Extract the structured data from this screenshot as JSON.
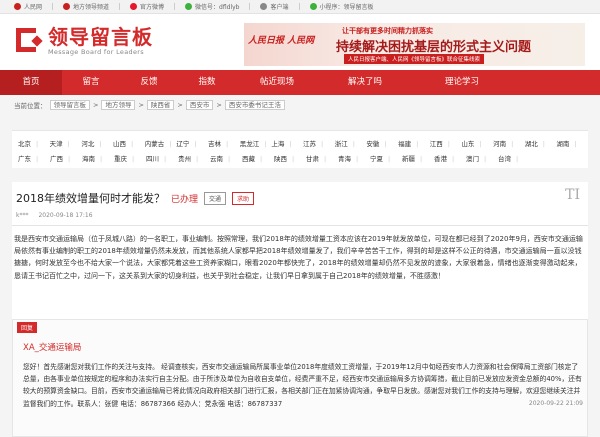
{
  "topbar": {
    "items": [
      {
        "label": "人民网",
        "icon": "people-daily-icon",
        "color": "#c9201f"
      },
      {
        "label": "地方领导频道",
        "icon": "channel-icon",
        "color": "#c9201f"
      },
      {
        "label": "官方微博",
        "icon": "weibo-icon",
        "color": "#e6162d"
      },
      {
        "label": "微信号：dfldlyb",
        "icon": "wechat-icon",
        "color": "#3db13d"
      },
      {
        "label": "客户端",
        "icon": "phone-icon",
        "color": "#888888"
      },
      {
        "label": "小程序：领导留言板",
        "icon": "miniprogram-icon",
        "color": "#3db13d"
      }
    ]
  },
  "header": {
    "logo_cn": "领导留言板",
    "logo_en": "Message Board for Leaders",
    "banner": {
      "logo": "人民日报 人民网",
      "line1": "让干部有更多时间精力抓落实",
      "line2": "持续解决困扰基层的形式主义问题",
      "line3": "人民日报客户端、人民网《领导留言板》联合征集线索"
    }
  },
  "nav": {
    "items": [
      "首页",
      "留言",
      "反馈",
      "指数",
      "帖近现场",
      "解决了吗",
      "理论学习"
    ],
    "active_index": 0
  },
  "breadcrumb": {
    "label": "当前位置：",
    "parts": [
      "领导留言板",
      "地方领导",
      "陕西省",
      "西安市",
      "西安市委书记王浩"
    ]
  },
  "regions": {
    "row1": [
      "北京",
      "天津",
      "河北",
      "山西",
      "内蒙古",
      "辽宁",
      "吉林",
      "黑龙江",
      "上海",
      "江苏",
      "浙江",
      "安徽",
      "福建",
      "江西",
      "山东",
      "河南",
      "湖北",
      "湖南"
    ],
    "row2": [
      "广东",
      "广西",
      "海南",
      "重庆",
      "四川",
      "贵州",
      "云南",
      "西藏",
      "陕西",
      "甘肃",
      "青海",
      "宁夏",
      "新疆",
      "香港",
      "澳门",
      "台湾"
    ]
  },
  "message": {
    "title": "2018年绩效增量何时才能发？",
    "status": "已办理",
    "tag1": "交通",
    "tag2": "求助",
    "author": "k***",
    "time": "2020-09-18 17:16",
    "body": "我是西安市交通运输局（位于凤城八路）的一名职工，事业编制。按照常理，我们2018年的绩效增量工资本应该在2019年就发放单位，可现在都已经到了2020年9月，西安市交通运输局依然有事业编制的职工的2018年绩效增量仍然未发放，而其他系统人家都早把2018年绩效增量发了，我们辛辛苦苦干工作，得到的却是这样不公正的待遇，市交通运输局一直以没钱搪搪，何时发放至今也不给大家一个说法，大家都凭着这些工资养家糊口，眼看2020年都快完了，2018年的绩效增量却仍然不见发放的迹象，大家很着急，情绪也逐渐变得激动起来，恳请王书记百忙之中，过问一下，这关系到大家的切身利益，也关乎到社会稳定，让我们早日拿到属于自己2018年的绩效增量，不胜感激！"
  },
  "reply": {
    "tag": "回复",
    "org": "XA_交通运输局",
    "body": "您好！首先感谢您对我们工作的关注与支持。   经调查核实，西安市交通运输局所属事业单位2018年度绩效工资增量，于2019年12月中旬经西安市人力资源和社会保障局工资部门核定了总量，由各事业单位按规定的程序和办法实行自主分配。由于所涉及单位为自收自支单位，经费严重不足，经西安市交通运输局多方协调筹措，截止目前已发放应发资金总额的40%，还有较大的预算资金缺口。目前，西安市交通运输局已将此情况向政府相关部门进行汇报，各相关部门正在加紧协调沟通，争取早日发放。感谢您对我们工作的支持与理解，欢迎您继续关注并监督我们的工作。联系人：张健 电话：86787366 经办人：党永强 电话：86787337",
    "date": "2020-09-22 21:09"
  }
}
